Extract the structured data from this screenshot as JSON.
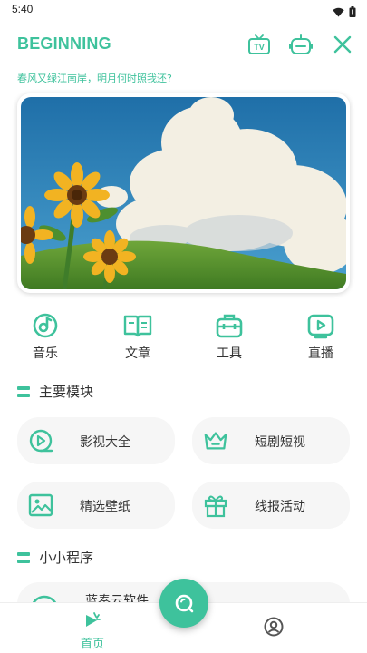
{
  "status_bar": {
    "time": "5:40",
    "icons": [
      "wifi-icon",
      "battery-icon"
    ]
  },
  "header": {
    "title": "BEGINNING",
    "icons": [
      "tv-icon",
      "robot-icon",
      "close-icon"
    ]
  },
  "poem": "春风又绿江南岸，明月何时照我还?",
  "quick_nav": [
    {
      "label": "音乐",
      "icon": "music-icon"
    },
    {
      "label": "文章",
      "icon": "book-icon"
    },
    {
      "label": "工具",
      "icon": "toolbox-icon"
    },
    {
      "label": "直播",
      "icon": "live-icon"
    }
  ],
  "sections": {
    "main_modules": {
      "title": "主要模块",
      "cards": [
        {
          "label": "影视大全",
          "icon": "film-icon"
        },
        {
          "label": "短剧短视",
          "icon": "crown-icon"
        },
        {
          "label": "精选壁纸",
          "icon": "image-icon"
        },
        {
          "label": "线报活动",
          "icon": "gift-icon"
        }
      ]
    },
    "mini_programs": {
      "title": "小小程序",
      "items": [
        {
          "label": "蓝奏云软件",
          "icon": "cloud-icon"
        }
      ]
    }
  },
  "bottom_nav": {
    "home_label": "首页",
    "items": [
      "home-icon",
      "profile-icon"
    ]
  },
  "fab": {
    "icon": "search-icon"
  },
  "colors": {
    "accent": "#3ec29c",
    "card_bg": "#f6f6f6",
    "text": "#333333"
  }
}
